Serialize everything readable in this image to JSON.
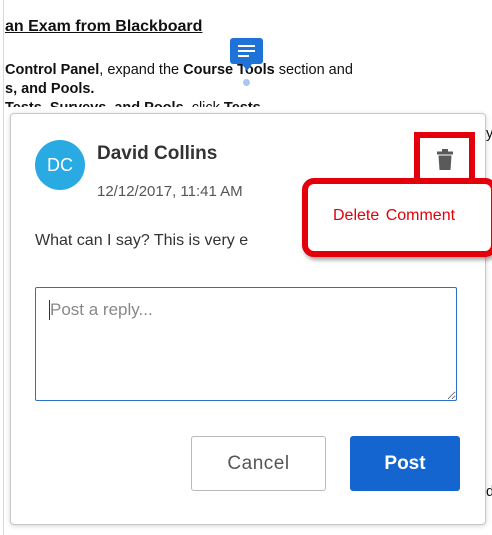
{
  "document": {
    "title": "an Exam from Blackboard",
    "line1_bold": "Control Panel",
    "line1_mid": ", expand the ",
    "line1_bold2": "Course Tools",
    "line1_tail": " section and",
    "line2": "s, and Pools.",
    "line3_bold": "Tests, Surveys, and Pools",
    "line3_mid": ", click ",
    "line3_bold2": "Tests",
    "edge_a": "y",
    "edge_b": "d"
  },
  "marker": {
    "icon": "comment-lines-icon",
    "color": "#1f73d6"
  },
  "comment": {
    "avatar_initials": "DC",
    "avatar_color": "#2aaae2",
    "author": "David Collins",
    "timestamp": "12/12/2017, 11:41 AM",
    "text": "What can I say? This is very e"
  },
  "delete": {
    "icon": "trash-icon",
    "tooltip": "Delete Comment",
    "highlight_color": "#e3000b"
  },
  "reply": {
    "placeholder": "Post a reply...",
    "value": ""
  },
  "buttons": {
    "cancel_label": "Cancel",
    "post_label": "Post",
    "post_color": "#1565d0"
  }
}
